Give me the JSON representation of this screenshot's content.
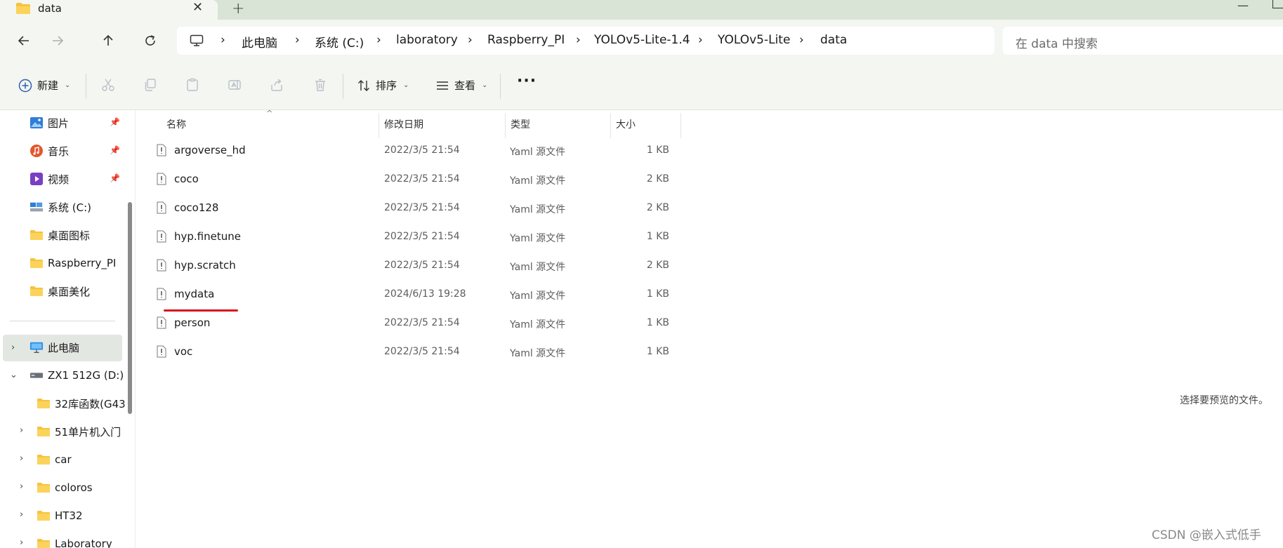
{
  "tab": {
    "title": "data",
    "close": "✕",
    "new_tab": "+"
  },
  "window": {
    "minimize": "—"
  },
  "address": {
    "breadcrumbs": [
      "此电脑",
      "系统 (C:)",
      "laboratory",
      "Raspberry_PI",
      "YOLOv5-Lite-1.4",
      "YOLOv5-Lite",
      "data"
    ],
    "separator": "›"
  },
  "search": {
    "placeholder": "在 data 中搜索"
  },
  "toolbar": {
    "new_label": "新建",
    "sort_label": "排序",
    "view_label": "查看",
    "more_label": "···"
  },
  "sidebar": {
    "quick": [
      {
        "label": "图片",
        "icon": "pictures-icon",
        "color": "#2f7dd6",
        "pinned": true
      },
      {
        "label": "音乐",
        "icon": "music-icon",
        "color": "#e4572e",
        "pinned": true
      },
      {
        "label": "视频",
        "icon": "video-icon",
        "color": "#7a3fc2",
        "pinned": true
      },
      {
        "label": "系统 (C:)",
        "icon": "drive-icon",
        "pinned": false
      },
      {
        "label": "桌面图标",
        "icon": "folder-icon",
        "pinned": false
      },
      {
        "label": "Raspberry_PI",
        "icon": "folder-icon",
        "pinned": false
      },
      {
        "label": "桌面美化",
        "icon": "folder-icon",
        "pinned": false
      }
    ],
    "tree": [
      {
        "label": "此电脑",
        "icon": "computer-icon",
        "expander": "collapsed"
      },
      {
        "label": "ZX1 512G (D:)",
        "icon": "drive-icon",
        "expander": "expanded"
      },
      {
        "label": "32库函数(G43",
        "icon": "folder-icon",
        "expander": "none"
      },
      {
        "label": "51单片机入门",
        "icon": "folder-icon",
        "expander": "collapsed"
      },
      {
        "label": "car",
        "icon": "folder-icon",
        "expander": "collapsed"
      },
      {
        "label": "coloros",
        "icon": "folder-icon",
        "expander": "collapsed"
      },
      {
        "label": "HT32",
        "icon": "folder-icon",
        "expander": "collapsed"
      },
      {
        "label": "Laboratory",
        "icon": "folder-icon",
        "expander": "collapsed"
      }
    ]
  },
  "columns": {
    "name": "名称",
    "date": "修改日期",
    "type": "类型",
    "size": "大小"
  },
  "files": [
    {
      "name": "argoverse_hd",
      "date": "2022/3/5 21:54",
      "type": "Yaml 源文件",
      "size": "1 KB"
    },
    {
      "name": "coco",
      "date": "2022/3/5 21:54",
      "type": "Yaml 源文件",
      "size": "2 KB"
    },
    {
      "name": "coco128",
      "date": "2022/3/5 21:54",
      "type": "Yaml 源文件",
      "size": "2 KB"
    },
    {
      "name": "hyp.finetune",
      "date": "2022/3/5 21:54",
      "type": "Yaml 源文件",
      "size": "1 KB"
    },
    {
      "name": "hyp.scratch",
      "date": "2022/3/5 21:54",
      "type": "Yaml 源文件",
      "size": "2 KB"
    },
    {
      "name": "mydata",
      "date": "2024/6/13 19:28",
      "type": "Yaml 源文件",
      "size": "1 KB"
    },
    {
      "name": "person",
      "date": "2022/3/5 21:54",
      "type": "Yaml 源文件",
      "size": "1 KB"
    },
    {
      "name": "voc",
      "date": "2022/3/5 21:54",
      "type": "Yaml 源文件",
      "size": "1 KB"
    }
  ],
  "preview_text": "选择要预览的文件。",
  "watermark": "CSDN @嵌入式低手",
  "colors": {
    "chrome": "#f3f6f1",
    "titlebar": "#d9e3d6",
    "folder": "#f7c23c",
    "annotation": "#d8141d"
  }
}
